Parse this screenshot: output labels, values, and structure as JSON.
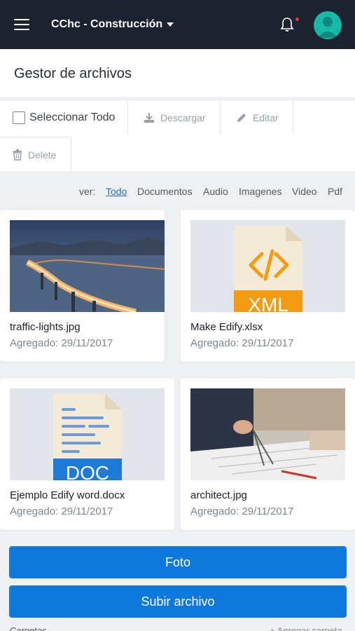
{
  "header": {
    "project": "CChc - Construcción",
    "icons": [
      "hamburger-menu-icon",
      "bell-icon",
      "user-avatar"
    ],
    "accent": "#0f78db",
    "bar_color": "#1d2230"
  },
  "page": {
    "title": "Gestor de archivos"
  },
  "toolbar": {
    "select_all": "Seleccionar Todo",
    "download": "Descargar",
    "edit": "Editar",
    "delete": "Delete"
  },
  "filter": {
    "prefix": "ver:",
    "options": [
      "Todo",
      "Documentos",
      "Audio",
      "Imagenes",
      "Video",
      "Pdf"
    ],
    "selected": "Todo"
  },
  "files": [
    {
      "name": "traffic-lights.jpg",
      "date": "Agregado: 29/11/2017",
      "type": "image"
    },
    {
      "name": "Make Edify.xlsx",
      "date": "Agregado: 29/11/2017",
      "type": "xml",
      "badge": "XML"
    },
    {
      "name": "Ejemplo Edify word.docx",
      "date": "Agregado: 29/11/2017",
      "type": "doc",
      "badge": "DOC"
    },
    {
      "name": "architect.jpg",
      "date": "Agregado: 29/11/2017",
      "type": "image"
    }
  ],
  "actions": {
    "photo": "Foto",
    "upload": "Subir archivo"
  },
  "bottom": {
    "left": "Carpetas",
    "right": "+ Agregar carpeta"
  }
}
